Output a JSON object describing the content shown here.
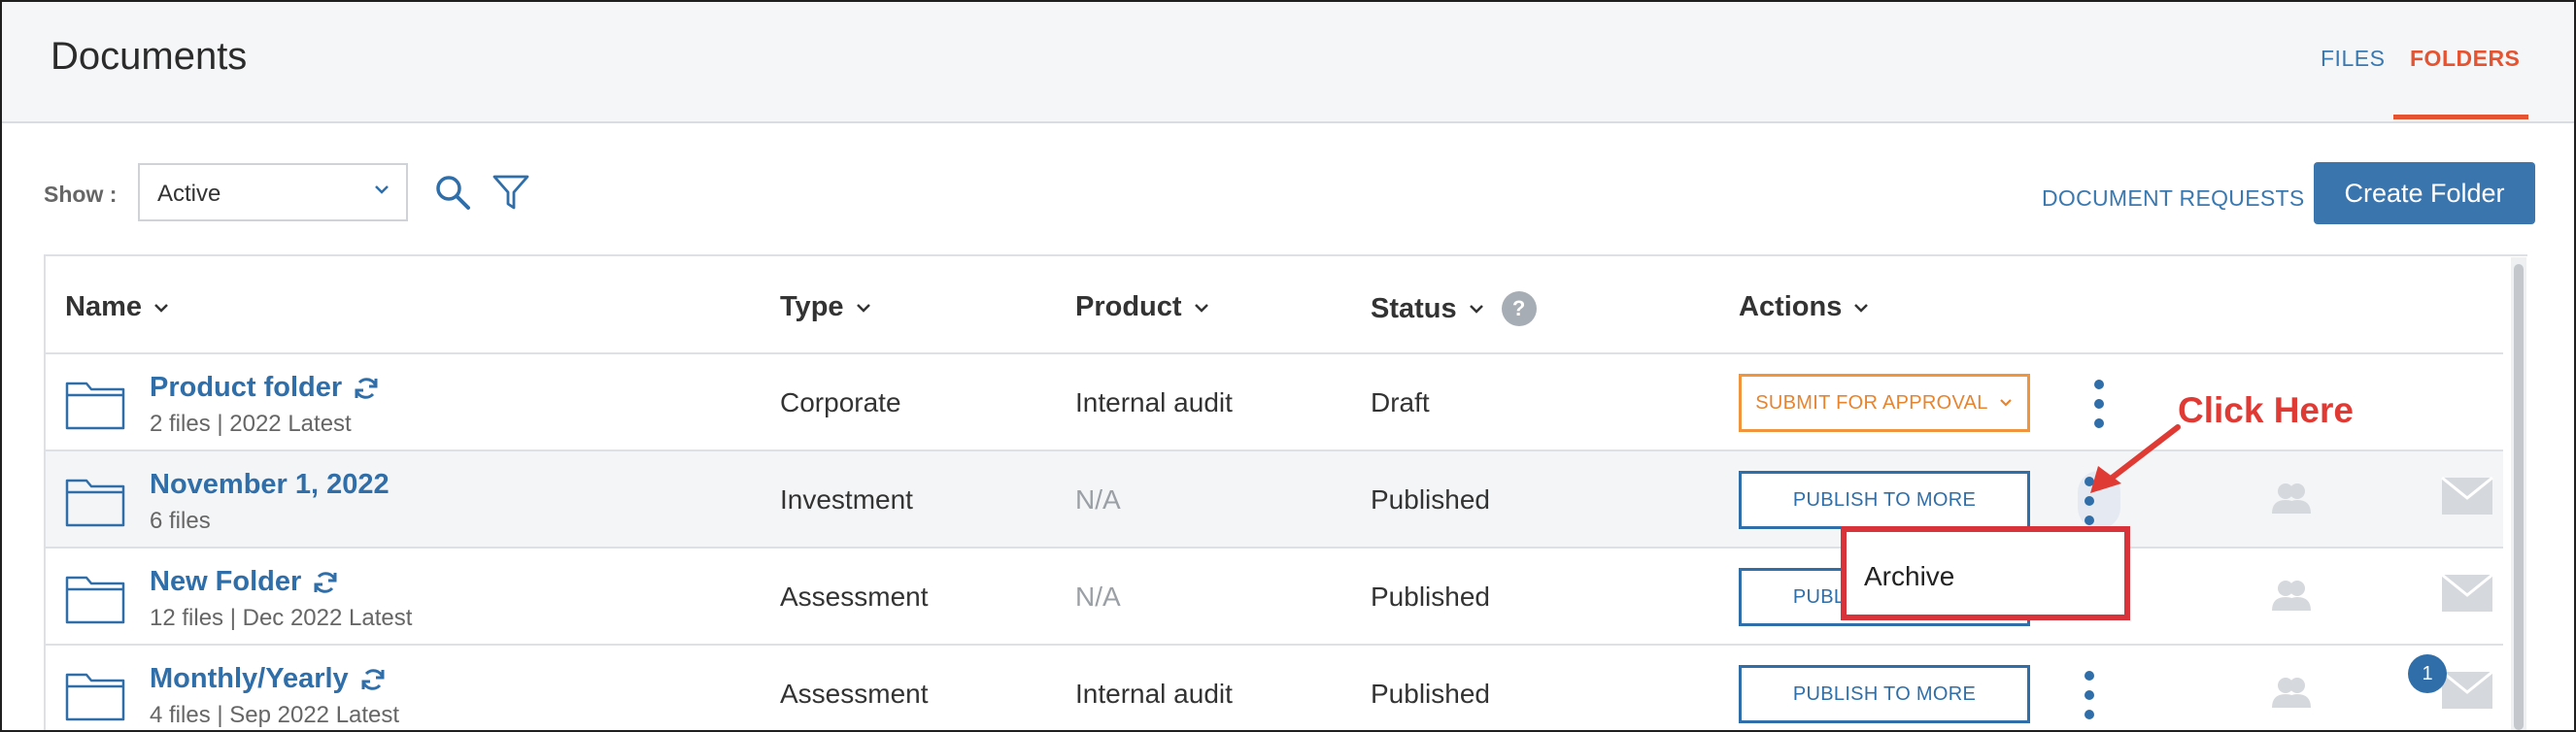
{
  "header": {
    "title": "Documents",
    "tabs": [
      {
        "label": "FILES",
        "active": false
      },
      {
        "label": "FOLDERS",
        "active": true
      }
    ]
  },
  "toolbar": {
    "show_label": "Show :",
    "show_value": "Active",
    "document_requests": "DOCUMENT REQUESTS",
    "create_folder": "Create Folder"
  },
  "table": {
    "columns": [
      "Name",
      "Type",
      "Product",
      "Status",
      "Actions"
    ],
    "status_help": "?",
    "rows": [
      {
        "name": "Product folder",
        "meta": "2 files | 2022 Latest",
        "type": "Corporate",
        "product": "Internal audit",
        "status": "Draft",
        "action": "SUBMIT FOR APPROVAL"
      },
      {
        "name": "November 1, 2022",
        "meta": "6 files",
        "type": "Investment",
        "product": "N/A",
        "status": "Published",
        "action": "PUBLISH TO MORE"
      },
      {
        "name": "New Folder",
        "meta": "12 files | Dec 2022 Latest",
        "type": "Assessment",
        "product": "N/A",
        "status": "Published",
        "action": "PUBLISH TO MORE"
      },
      {
        "name": "Monthly/Yearly",
        "meta": "4 files | Sep 2022 Latest",
        "type": "Assessment",
        "product": "Internal audit",
        "status": "Published",
        "action": "PUBLISH TO MORE"
      }
    ]
  },
  "menu": {
    "items": [
      "Archive"
    ]
  },
  "annotation": {
    "text": "Click Here"
  },
  "notification_badge": "1",
  "colors": {
    "accent": "#3b75ad",
    "active_tab": "#e55330",
    "annotation": "#e03a35",
    "approval": "#f0953d"
  }
}
